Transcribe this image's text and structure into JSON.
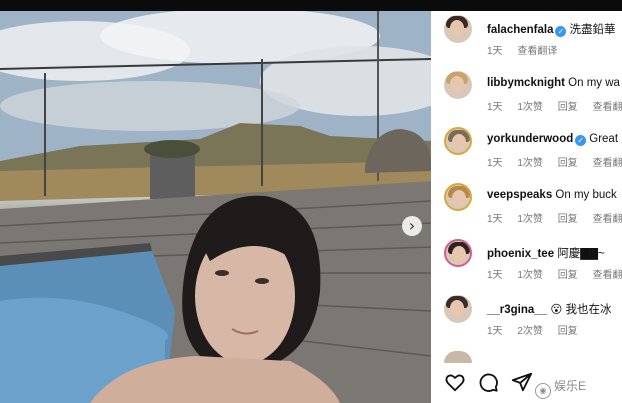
{
  "carousel": {
    "next_glyph": "›"
  },
  "comments": [
    {
      "username": "falachenfala",
      "verified": true,
      "text": "洗盡鉛華",
      "time": "1天",
      "likes": "",
      "reply": "",
      "translate": "查看翻译"
    },
    {
      "username": "libbymcknight",
      "verified": false,
      "text": "On my wa",
      "time": "1天",
      "likes": "1次赞",
      "reply": "回复",
      "translate": "查看翻译"
    },
    {
      "username": "yorkunderwood",
      "verified": true,
      "text": "Great",
      "time": "1天",
      "likes": "1次赞",
      "reply": "回复",
      "translate": "查看翻译"
    },
    {
      "username": "veepspeaks",
      "verified": false,
      "text": "On my buck",
      "time": "1天",
      "likes": "1次赞",
      "reply": "回复",
      "translate": "查看翻译"
    },
    {
      "username": "phoenix_tee",
      "verified": false,
      "text": "阿慶▇▇~",
      "time": "1天",
      "likes": "1次赞",
      "reply": "回复",
      "translate": "查看翻译"
    },
    {
      "username": "__r3gina__",
      "verified": false,
      "text": "😮 我也在冰",
      "time": "1天",
      "likes": "2次赞",
      "reply": "回复",
      "translate": ""
    }
  ],
  "actions": {
    "icons": [
      "heart-icon",
      "comment-icon",
      "share-icon"
    ]
  },
  "watermark": {
    "text": "娱乐E"
  }
}
